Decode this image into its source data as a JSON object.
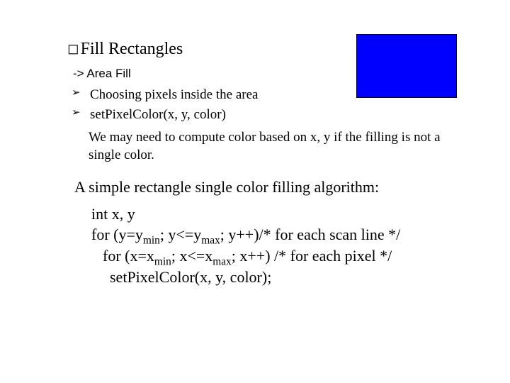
{
  "title": {
    "glyph": "◻",
    "text": "Fill Rectangles"
  },
  "subheading": "-> Area Fill",
  "bullets": [
    "Choosing pixels inside the area",
    "setPixelColor(x, y, color)"
  ],
  "follow_text": "We may need to compute color based on x, y if the filling is not a single color.",
  "algo_intro": "A simple rectangle single color filling algorithm:",
  "code": {
    "decl": "int x, y",
    "for_y_a": "for (y=y",
    "for_y_sub1": "min",
    "for_y_b": "; y<=y",
    "for_y_sub2": "max",
    "for_y_c": "; y++)/* for each scan line */",
    "for_x_a": "for (x=x",
    "for_x_sub1": "min",
    "for_x_b": "; x<=x",
    "for_x_sub2": "max",
    "for_x_c": "; x++)  /* for each pixel */",
    "set": "setPixelColor(x, y, color);"
  },
  "rect_color": "#0000ff"
}
